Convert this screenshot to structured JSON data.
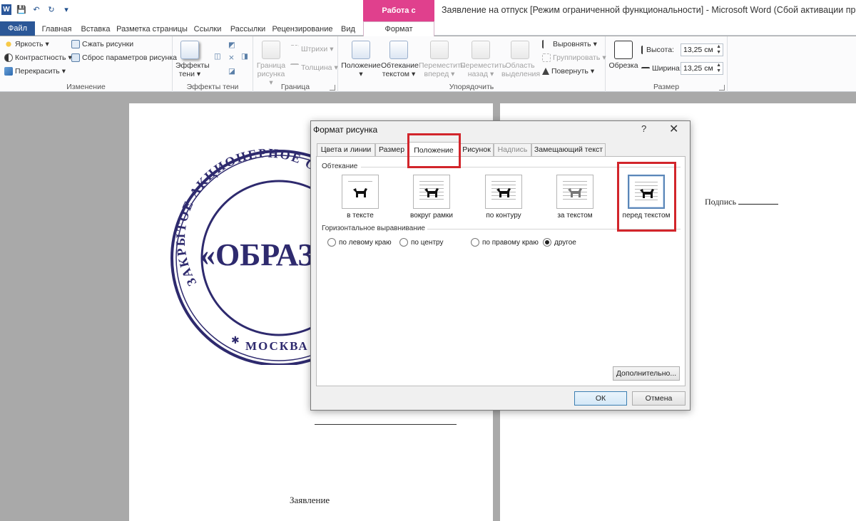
{
  "app": {
    "doc_title": "Заявление на отпуск [Режим ограниченной функциональности]  -  Microsoft Word (Сбой активации продукта)",
    "context_tab_title": "Работа с рисунками",
    "logo_letter": "W"
  },
  "qat": {
    "save": "💾",
    "undo": "↶",
    "redo": "↻",
    "dropdown": "▾"
  },
  "tabs": {
    "file": "Файл",
    "items": [
      "Главная",
      "Вставка",
      "Разметка страницы",
      "Ссылки",
      "Рассылки",
      "Рецензирование",
      "Вид"
    ],
    "format": "Формат"
  },
  "ribbon": {
    "change": {
      "label": "Изменение",
      "brightness": "Яркость",
      "contrast": "Контрастность",
      "recolor": "Перекрасить",
      "compress": "Сжать рисунки",
      "reset": "Сброс параметров рисунка"
    },
    "shadow": {
      "label": "Эффекты тени",
      "effects_line1": "Эффекты",
      "effects_line2": "тени"
    },
    "border": {
      "label": "Граница",
      "border_line1": "Граница",
      "border_line2": "рисунка",
      "dashes": "Штрихи",
      "weight": "Толщина"
    },
    "arrange": {
      "label": "Упорядочить",
      "position": "Положение",
      "wrap_line1": "Обтекание",
      "wrap_line2": "текстом",
      "forward_line1": "Переместить",
      "forward_line2": "вперед",
      "backward_line1": "Переместить",
      "backward_line2": "назад",
      "selection_line1": "Область",
      "selection_line2": "выделения",
      "align": "Выровнять",
      "group": "Группировать",
      "rotate": "Повернуть"
    },
    "size": {
      "label": "Размер",
      "crop": "Обрезка",
      "height_label": "Высота:",
      "height_value": "13,25 см",
      "width_label": "Ширина:",
      "width_value": "13,25 см"
    }
  },
  "document": {
    "signature": "Подпись",
    "zayavlenie": "Заявление",
    "stamp": {
      "top_arc": "ЗАКРЫТОЕ АКЦИОНЕРНОЕ ОБЩЕСТВО",
      "center": "«ОБРАЗ",
      "bottom": "МОСКВА"
    }
  },
  "dialog": {
    "title": "Формат рисунка",
    "help": "?",
    "close": "✕",
    "tabs": [
      {
        "label": "Цвета и линии"
      },
      {
        "label": "Размер"
      },
      {
        "label": "Положение"
      },
      {
        "label": "Рисунок"
      },
      {
        "label": "Надпись"
      },
      {
        "label": "Замещающий текст"
      }
    ],
    "wrapping_label": "Обтекание",
    "wrap_options": [
      {
        "label": "в тексте"
      },
      {
        "label": "вокруг рамки"
      },
      {
        "label": "по контуру"
      },
      {
        "label": "за текстом"
      },
      {
        "label": "перед текстом"
      }
    ],
    "h_align_label": "Горизонтальное выравнивание",
    "h_align_options": [
      {
        "label": "по левому краю"
      },
      {
        "label": "по центру"
      },
      {
        "label": "по правому краю"
      },
      {
        "label": "другое"
      }
    ],
    "selected_h_align": "другое",
    "advanced": "Дополнительно...",
    "ok": "ОК",
    "cancel": "Отмена"
  },
  "colors": {
    "file_tab": "#2b5797",
    "context_tab": "#e0408d",
    "stamp_ink": "#2e2a6e",
    "highlight": "#d2252b"
  }
}
